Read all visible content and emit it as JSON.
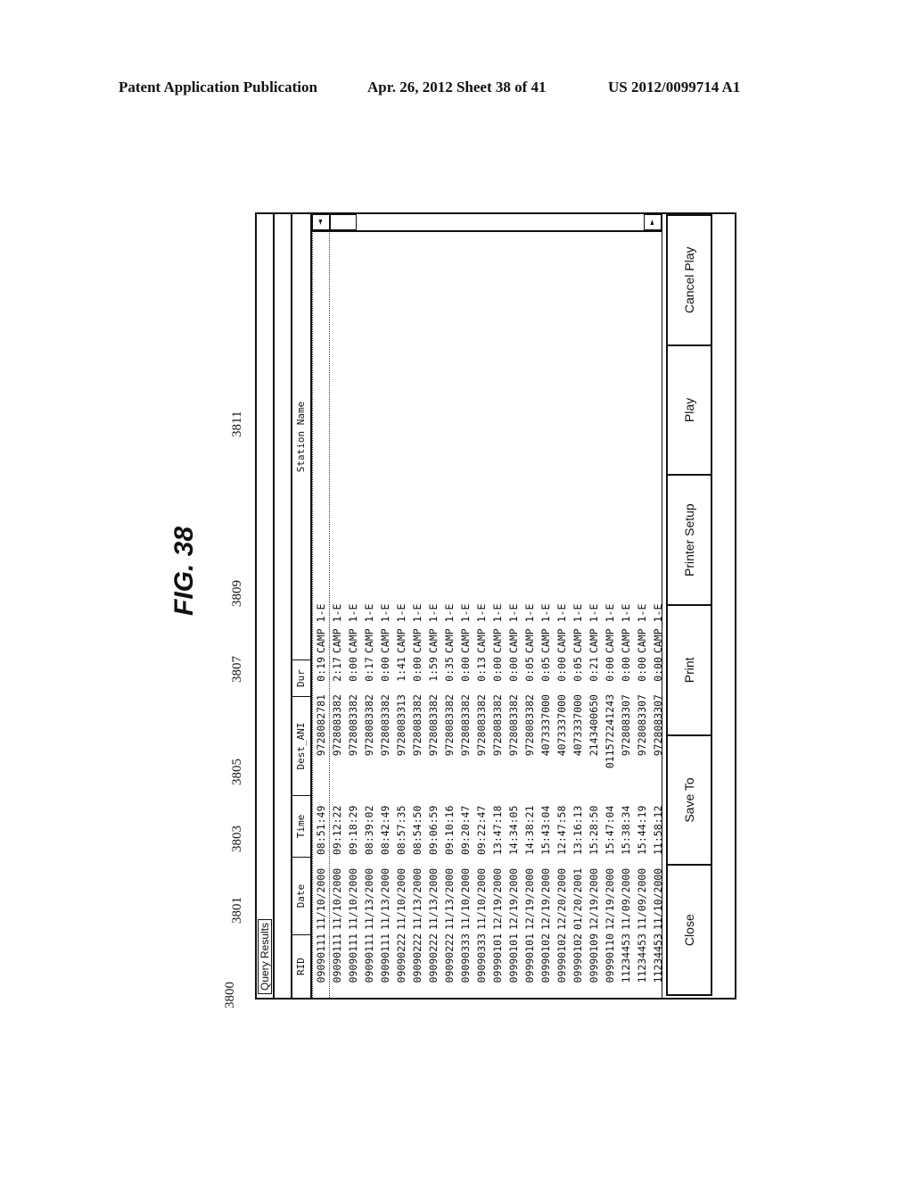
{
  "header": {
    "left": "Patent Application Publication",
    "middle": "Apr. 26, 2012  Sheet 38 of 41",
    "right": "US 2012/0099714 A1"
  },
  "figure_label": "FIG. 38",
  "refs": {
    "window": "3800",
    "rid": "3801",
    "date": "3803",
    "time": "3805",
    "dest_ani": "3807",
    "dur": "3809",
    "station": "3811"
  },
  "window": {
    "title": "Query Results",
    "columns": [
      "RID",
      "Date",
      "Time",
      "Dest_ANI",
      "Dur",
      "Station Name"
    ],
    "rows": [
      [
        "09090111",
        "11/10/2000",
        "08:51:49",
        "9728082781",
        "0:19",
        "CAMP 1-E"
      ],
      [
        "09090111",
        "11/10/2000",
        "09:12:22",
        "9728083382",
        "2:17",
        "CAMP 1-E"
      ],
      [
        "09090111",
        "11/10/2000",
        "09:18:29",
        "9728083382",
        "0:00",
        "CAMP 1-E"
      ],
      [
        "09090111",
        "11/13/2000",
        "08:39:02",
        "9728083382",
        "0:17",
        "CAMP 1-E"
      ],
      [
        "09090111",
        "11/13/2000",
        "08:42:49",
        "9728083382",
        "0:00",
        "CAMP 1-E"
      ],
      [
        "09090222",
        "11/10/2000",
        "08:57:35",
        "9728083313",
        "1:41",
        "CAMP 1-E"
      ],
      [
        "09090222",
        "11/13/2000",
        "08:54:50",
        "9728083382",
        "0:00",
        "CAMP 1-E"
      ],
      [
        "09090222",
        "11/13/2000",
        "09:06:59",
        "9728083382",
        "1:59",
        "CAMP 1-E"
      ],
      [
        "09090222",
        "11/13/2000",
        "09:10:16",
        "9728083382",
        "0:35",
        "CAMP 1-E"
      ],
      [
        "09090333",
        "11/10/2000",
        "09:20:47",
        "9728083382",
        "0:00",
        "CAMP 1-E"
      ],
      [
        "09090333",
        "11/10/2000",
        "09:22:47",
        "9728083382",
        "0:13",
        "CAMP 1-E"
      ],
      [
        "09990101",
        "12/19/2000",
        "13:47:18",
        "9728083382",
        "0:00",
        "CAMP 1-E"
      ],
      [
        "09990101",
        "12/19/2000",
        "14:34:05",
        "9728083382",
        "0:00",
        "CAMP 1-E"
      ],
      [
        "09990101",
        "12/19/2000",
        "14:38:21",
        "9728083382",
        "0:05",
        "CAMP 1-E"
      ],
      [
        "09990102",
        "12/19/2000",
        "15:43:04",
        "4073337000",
        "0:05",
        "CAMP 1-E"
      ],
      [
        "09990102",
        "12/20/2000",
        "12:47:58",
        "4073337000",
        "0:00",
        "CAMP 1-E"
      ],
      [
        "09990102",
        "01/20/2001",
        "13:16:13",
        "4073337000",
        "0:05",
        "CAMP 1-E"
      ],
      [
        "09990109",
        "12/19/2000",
        "15:28:50",
        "2143400650",
        "0:21",
        "CAMP 1-E"
      ],
      [
        "09990110",
        "12/19/2000",
        "15:47:04",
        "011572241243",
        "0:00",
        "CAMP 1-E"
      ],
      [
        "11234453",
        "11/09/2000",
        "15:38:34",
        "9728083307",
        "0:00",
        "CAMP 1-E"
      ],
      [
        "11234453",
        "11/09/2000",
        "15:44:19",
        "9728083307",
        "0:00",
        "CAMP 1-E"
      ],
      [
        "11234453",
        "11/10/2000",
        "11:58:12",
        "9728083307",
        "0:00",
        "CAMP 1-E"
      ]
    ],
    "buttons": [
      "Close",
      "Save To",
      "Print",
      "Printer Setup",
      "Play",
      "Cancel Play"
    ],
    "scroll": {
      "left_arrow": "◄",
      "right_arrow": "►"
    }
  }
}
